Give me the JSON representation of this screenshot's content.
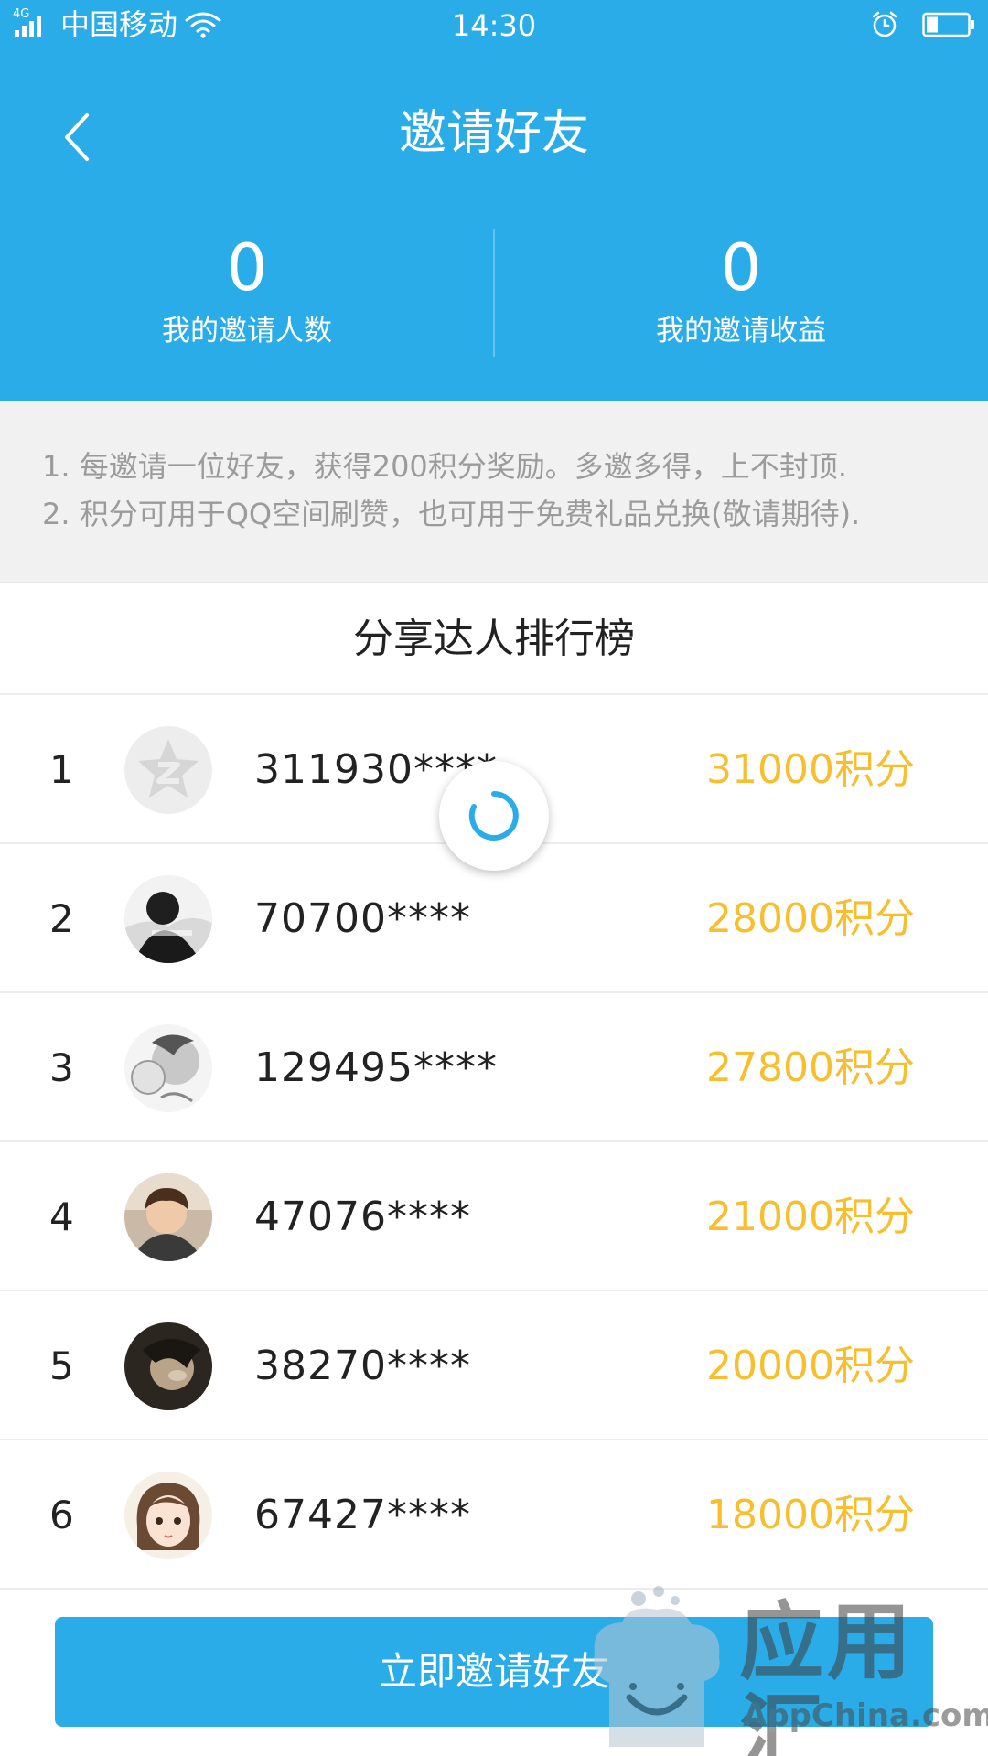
{
  "status_bar": {
    "network": "4G",
    "carrier": "中国移动",
    "time": "14:30",
    "icons": [
      "signal-icon",
      "wifi-icon",
      "alarm-icon",
      "battery-icon"
    ]
  },
  "header": {
    "title": "邀请好友",
    "back_icon": "chevron-left-icon",
    "stats": [
      {
        "value": "0",
        "label": "我的邀请人数"
      },
      {
        "value": "0",
        "label": "我的邀请收益"
      }
    ]
  },
  "rules": [
    "1. 每邀请一位好友，获得200积分奖励。多邀多得，上不封顶.",
    "2. 积分可用于QQ空间刷赞，也可用于免费礼品兑换(敬请期待)."
  ],
  "leaderboard": {
    "title": "分享达人排行榜",
    "rows": [
      {
        "rank": "1",
        "user": "311930****",
        "points": "31000积分"
      },
      {
        "rank": "2",
        "user": "70700****",
        "points": "28000积分"
      },
      {
        "rank": "3",
        "user": "129495****",
        "points": "27800积分"
      },
      {
        "rank": "4",
        "user": "47076****",
        "points": "21000积分"
      },
      {
        "rank": "5",
        "user": "38270****",
        "points": "20000积分"
      },
      {
        "rank": "6",
        "user": "67427****",
        "points": "18000积分"
      }
    ]
  },
  "invite_button": {
    "label": "立即邀请好友"
  },
  "watermark": {
    "cn": "应用汇",
    "en": "AppChina.com"
  },
  "colors": {
    "primary": "#2aace8",
    "points": "#f7be2e",
    "rules_bg": "#f1f1f1",
    "rules_text": "#9b9b9b"
  }
}
